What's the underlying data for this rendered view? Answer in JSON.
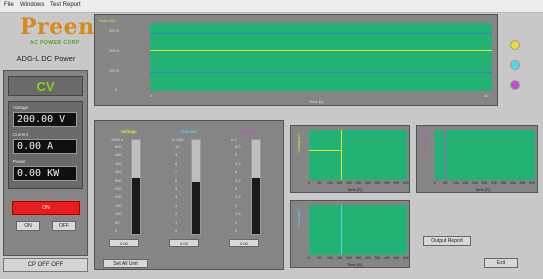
{
  "menu": {
    "file": "File",
    "windows": "Windows",
    "test_report": "Test Report"
  },
  "logo": {
    "brand": "Preen",
    "tagline": "AC POWER CORP"
  },
  "product": "ADG-L DC Power",
  "mode": "CV",
  "readings": {
    "voltage_label": "Voltage",
    "voltage_value": "200.00 V",
    "current_label": "Current",
    "current_value": "0.00 A",
    "power_label": "Power",
    "power_value": "0.00 KW"
  },
  "buttons": {
    "on_off": "ON",
    "left_small": "ON",
    "right_small": "OFF",
    "cp_status": "CP OFF OFF",
    "set_all": "Set All Unit",
    "output_report": "Output Report",
    "exit": "Exit"
  },
  "main_chart": {
    "ylabels": [
      "300.0",
      "200.0",
      "100.0",
      "0"
    ],
    "xlabel": "Time (s)",
    "ytop_label": "Volts 200",
    "x_start": "0",
    "x_end": "60"
  },
  "meters": [
    {
      "title": "Voltage",
      "color": "#e8e030",
      "max": "1000.0",
      "ticks": [
        "500",
        "450",
        "400",
        "350",
        "300",
        "250",
        "200",
        "150",
        "100",
        "50",
        "0"
      ],
      "level": 0.6,
      "input": "0.00"
    },
    {
      "title": "Current",
      "color": "#50d8e8",
      "max": "12.000",
      "ticks": [
        "10",
        "9",
        "8",
        "7",
        "6",
        "5",
        "4",
        "3",
        "2",
        "1",
        "0"
      ],
      "level": 0.55,
      "input": "0.00"
    },
    {
      "title": "Power",
      "color": "#c050c8",
      "max": "6.0",
      "ticks": [
        "5.5",
        "5",
        "4.5",
        "4",
        "3.5",
        "3",
        "2.5",
        "2",
        "1.5",
        "1",
        "0"
      ],
      "level": 0.6,
      "input": "0.00"
    }
  ],
  "small_charts": {
    "x_ticks": [
      "0",
      "50",
      "100",
      "150",
      "200",
      "250",
      "300",
      "350",
      "400",
      "450",
      "500"
    ],
    "xlabel": "Time (S)",
    "voltage_ylabel": "Voltage(V)",
    "power_ylabel": "Power(W)",
    "current_ylabel": "Current(A)"
  },
  "indicator_colors": [
    "#e8e030",
    "#50d8e8",
    "#c050c8"
  ],
  "colors": {
    "plot_bg": "#22b274",
    "on_button": "#e81c1c",
    "mode_text": "#7ed321"
  }
}
